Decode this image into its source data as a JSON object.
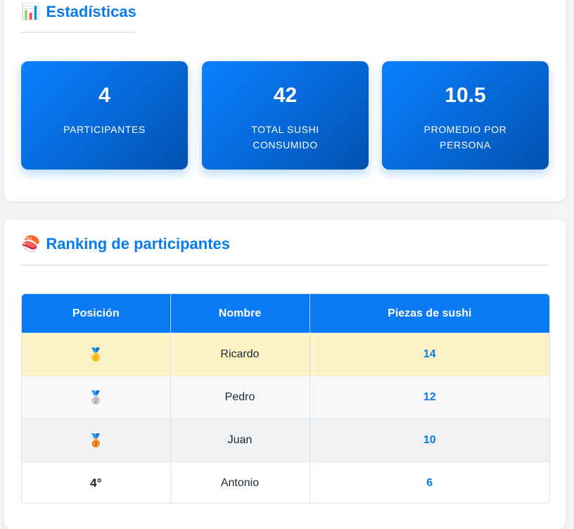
{
  "stats": {
    "icon": "bar-chart-emoji",
    "title_emoji": "📊",
    "title": "Estadísticas",
    "items": [
      {
        "value": "4",
        "label": "PARTICIPANTES"
      },
      {
        "value": "42",
        "label": "TOTAL SUSHI CONSUMIDO"
      },
      {
        "value": "10.5",
        "label": "PROMEDIO POR PERSONA"
      }
    ]
  },
  "ranking": {
    "icon": "sushi-emoji",
    "title_emoji": "🍣",
    "title": "Ranking de participantes",
    "headers": [
      "Posición",
      "Nombre",
      "Piezas de sushi"
    ],
    "rows": [
      {
        "position": "🥇",
        "name": "Ricardo",
        "pieces": "14"
      },
      {
        "position": "🥈",
        "name": "Pedro",
        "pieces": "12"
      },
      {
        "position": "🥉",
        "name": "Juan",
        "pieces": "10"
      },
      {
        "position": "4°",
        "name": "Antonio",
        "pieces": "6"
      }
    ]
  },
  "colors": {
    "accent": "#0a7bec",
    "gold_row": "#fdf1c6",
    "header_bg": "#0a7bf5"
  }
}
